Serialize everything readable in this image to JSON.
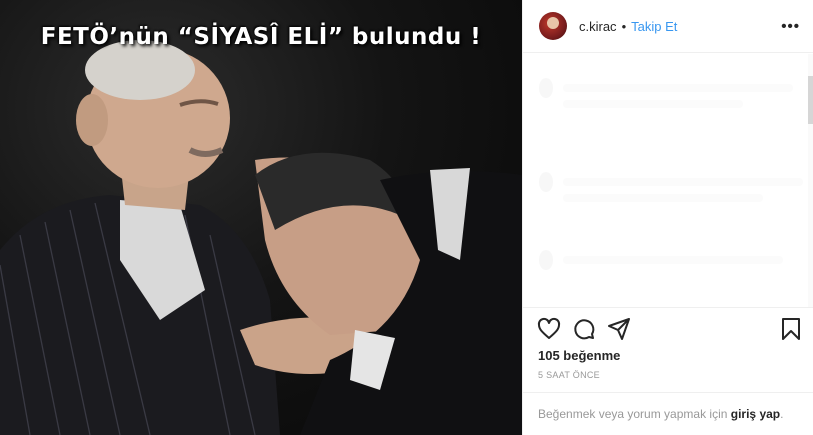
{
  "image": {
    "caption": "FETÖ’nün “SİYASÎ ELİ” bulundu !"
  },
  "header": {
    "username": "c.kirac",
    "separator": "•",
    "follow_label": "Takip Et",
    "more_label": "•••"
  },
  "actions": {
    "like_icon": "heart-icon",
    "comment_icon": "comment-icon",
    "share_icon": "share-icon",
    "save_icon": "bookmark-icon"
  },
  "stats": {
    "likes": "105 beğenme",
    "timestamp": "5 SAAT ÖNCE"
  },
  "login_prompt": {
    "text": "Beğenmek veya yorum yapmak için",
    "link": "giriş yap",
    "suffix": "."
  },
  "colors": {
    "link": "#3897f0",
    "text": "#262626",
    "muted": "#999999",
    "border": "#efefef"
  }
}
